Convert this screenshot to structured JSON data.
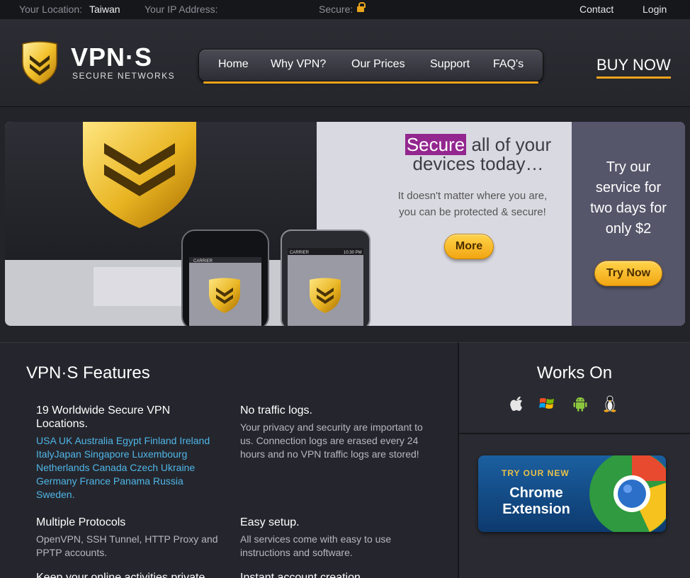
{
  "topbar": {
    "location_label": "Your Location:",
    "location_value": "Taiwan",
    "ip_label": "Your IP Address:",
    "secure_label": "Secure:",
    "lock_icon": "unlocked-padlock-icon",
    "contact": "Contact",
    "login": "Login"
  },
  "brand": {
    "name": "VPN·S",
    "tagline": "SECURE NETWORKS",
    "shield_icon": "gold-shield-chevron-icon"
  },
  "nav": {
    "items": [
      "Home",
      "Why VPN?",
      "Our Prices",
      "Support",
      "FAQ's"
    ]
  },
  "buy_now": "BUY NOW",
  "hero": {
    "headline_highlight": "Secure",
    "headline_rest_line1": " all of your",
    "headline_line2": "devices today…",
    "text_line1": "It doesn't matter where you are,",
    "text_line2": "you can be protected & secure!",
    "more_button": "More",
    "phone_status_left": "CARRIER",
    "android_status_left": "CARRIER",
    "android_status_time": "10:30 PM"
  },
  "trial": {
    "line1": "Try our",
    "line2": "service for",
    "line3": "two days for",
    "line4": "only $2",
    "button": "Try Now"
  },
  "features": {
    "title": "VPN·S Features",
    "items": [
      {
        "title": "19 Worldwide Secure VPN Locations.",
        "locations": "USA UK Australia Egypt Finland Ireland ItalyJapan Singapore Luxembourg Netherlands Canada Czech Ukraine Germany France Panama Russia Sweden."
      },
      {
        "title": "No traffic logs.",
        "desc": "Your privacy and security are important to us. Connection logs are erased every 24 hours and no VPN traffic logs are stored!"
      },
      {
        "title": "Multiple Protocols",
        "desc": "OpenVPN, SSH Tunnel, HTTP Proxy and PPTP accounts."
      },
      {
        "title": "Easy setup.",
        "desc": "All services come with easy to use instructions and software."
      },
      {
        "title": "Keep your online activities private",
        "desc": ""
      },
      {
        "title": "Instant account creation",
        "desc": ""
      }
    ]
  },
  "works_on": {
    "title": "Works On",
    "icons": [
      "apple-icon",
      "windows-icon",
      "android-icon",
      "linux-icon"
    ]
  },
  "chrome_ad": {
    "small": "TRY OUR NEW",
    "line1": "Chrome",
    "line2": "Extension",
    "icon": "chrome-logo-icon"
  },
  "colors": {
    "accent": "#f0a41a",
    "highlight": "#93278f",
    "link": "#4fb6e8"
  }
}
